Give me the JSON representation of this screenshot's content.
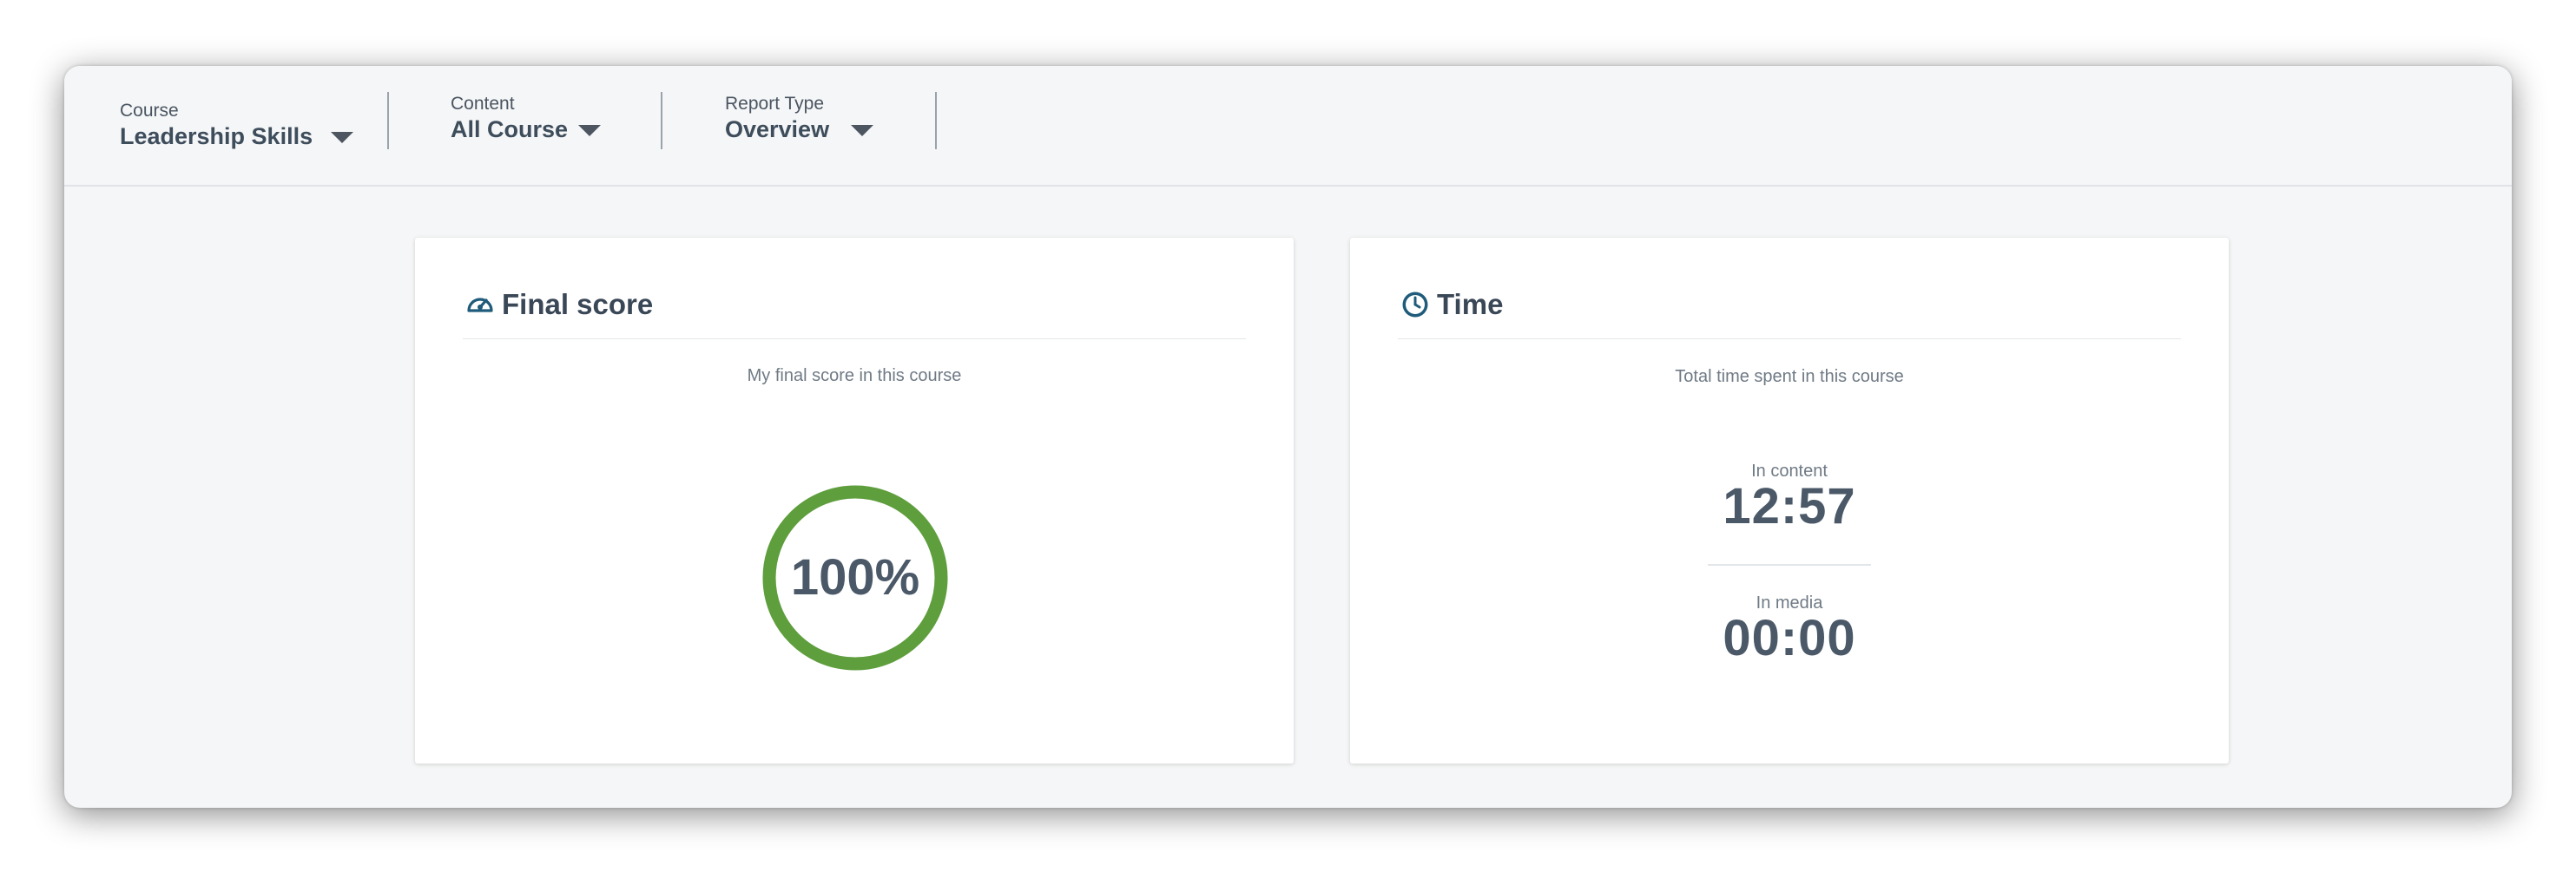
{
  "filters": [
    {
      "label": "Course",
      "value": "Leadership Skills"
    },
    {
      "label": "Content",
      "value": "All Course"
    },
    {
      "label": "Report Type",
      "value": "Overview"
    }
  ],
  "final_score": {
    "title": "Final score",
    "subtitle": "My final score in this course",
    "value_text": "100%",
    "progress": 1.0,
    "ring_color": "#5e9e3c",
    "icon": "speedometer-icon"
  },
  "time": {
    "title": "Time",
    "subtitle": "Total time spent in this course",
    "icon": "clock-icon",
    "in_content_label": "In content",
    "in_content_value": "12:57",
    "in_media_label": "In media",
    "in_media_value": "00:00"
  }
}
